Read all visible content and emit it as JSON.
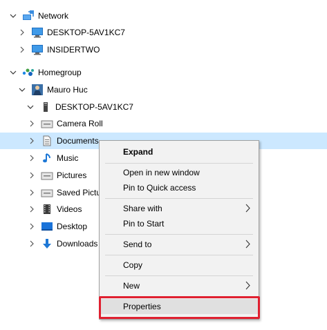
{
  "tree": {
    "network": {
      "label": "Network"
    },
    "network_items": [
      {
        "label": "DESKTOP-5AV1KC7"
      },
      {
        "label": "INSIDERTWO"
      }
    ],
    "homegroup": {
      "label": "Homegroup"
    },
    "user": {
      "label": "Mauro Huc"
    },
    "desktop_pc": {
      "label": "DESKTOP-5AV1KC7"
    },
    "folders": [
      {
        "label": "Camera Roll"
      },
      {
        "label": "Documents"
      },
      {
        "label": "Music"
      },
      {
        "label": "Pictures"
      },
      {
        "label": "Saved Pictu"
      },
      {
        "label": "Videos"
      },
      {
        "label": "Desktop"
      },
      {
        "label": "Downloads"
      }
    ]
  },
  "context_menu": {
    "expand": "Expand",
    "open_new_window": "Open in new window",
    "pin_quick_access": "Pin to Quick access",
    "share_with": "Share with",
    "pin_start": "Pin to Start",
    "send_to": "Send to",
    "copy": "Copy",
    "new": "New",
    "properties": "Properties"
  },
  "colors": {
    "selection": "#cce8ff",
    "highlight_border": "#e02030",
    "menu_background": "#f2f2f2"
  }
}
